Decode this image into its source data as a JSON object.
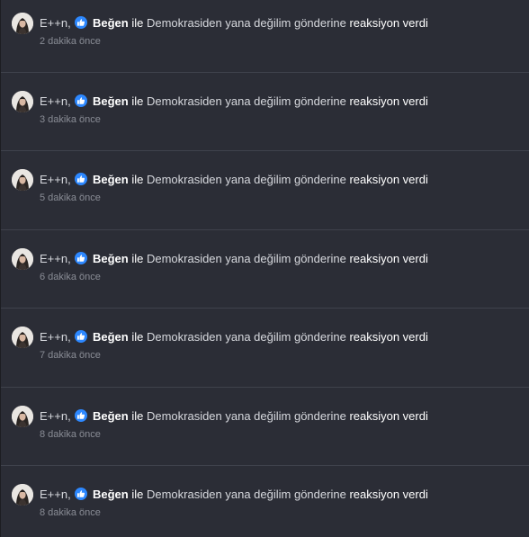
{
  "notifications": [
    {
      "user": "E++n,",
      "reaction": "Beğen",
      "connector": "ile",
      "text": "Demokrasiden yana değilim gönderine",
      "action": "reaksiyon verdi",
      "time": "2 dakika önce"
    },
    {
      "user": "E++n,",
      "reaction": "Beğen",
      "connector": "ile",
      "text": "Demokrasiden yana değilim gönderine",
      "action": "reaksiyon verdi",
      "time": "3 dakika önce"
    },
    {
      "user": "E++n,",
      "reaction": "Beğen",
      "connector": "ile",
      "text": "Demokrasiden yana değilim gönderine",
      "action": "reaksiyon verdi",
      "time": "5 dakika önce"
    },
    {
      "user": "E++n,",
      "reaction": "Beğen",
      "connector": "ile",
      "text": "Demokrasiden yana değilim gönderine",
      "action": "reaksiyon verdi",
      "time": "6 dakika önce"
    },
    {
      "user": "E++n,",
      "reaction": "Beğen",
      "connector": "ile",
      "text": "Demokrasiden yana değilim gönderine",
      "action": "reaksiyon verdi",
      "time": "7 dakika önce"
    },
    {
      "user": "E++n,",
      "reaction": "Beğen",
      "connector": "ile",
      "text": "Demokrasiden yana değilim gönderine",
      "action": "reaksiyon verdi",
      "time": "8 dakika önce"
    },
    {
      "user": "E++n,",
      "reaction": "Beğen",
      "connector": "ile",
      "text": "Demokrasiden yana değilim gönderine",
      "action": "reaksiyon verdi",
      "time": "8 dakika önce"
    }
  ],
  "icons": {
    "avatar": "user-avatar",
    "reaction": "thumbs-up-icon"
  },
  "colors": {
    "background": "#2b2d36",
    "divider": "#3f424c",
    "like_badge": "#2d88ff",
    "text": "#d7d9de",
    "time": "#8a8d96"
  }
}
